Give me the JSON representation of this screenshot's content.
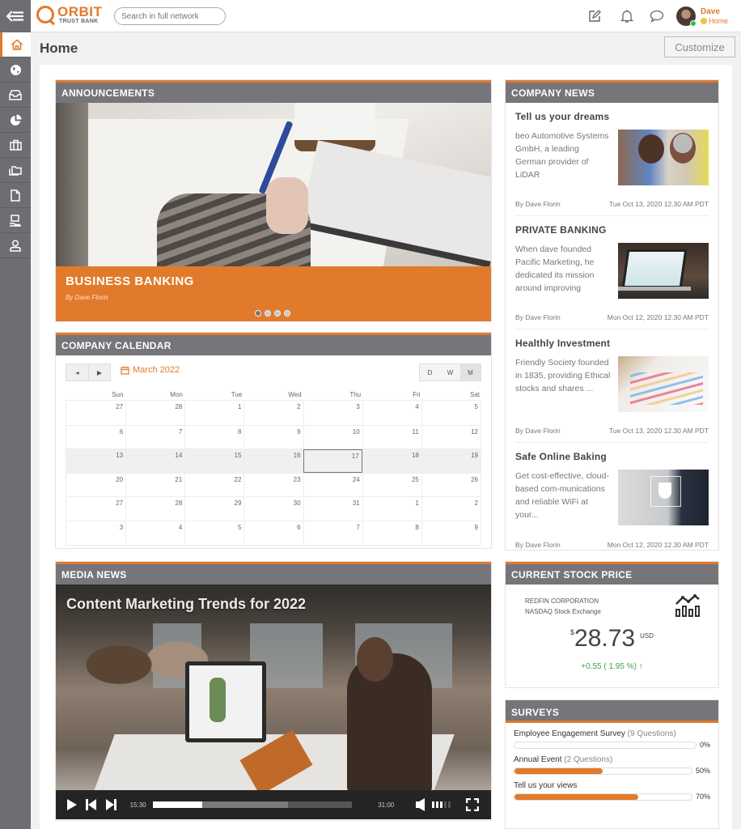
{
  "brand": {
    "name": "ORBIT",
    "tagline": "TRUST BANK",
    "accent_color": "#e27a2c",
    "header_gray": "#75757a"
  },
  "topbar": {
    "search_placeholder": "Search in full network",
    "icons": [
      "compose-icon",
      "bell-icon",
      "chat-icon"
    ],
    "user": {
      "name": "Dave",
      "status": "Home",
      "presence": "online"
    }
  },
  "sidebar": {
    "items": [
      {
        "name": "home",
        "icon": "home-icon",
        "active": true
      },
      {
        "name": "globe",
        "icon": "globe-icon"
      },
      {
        "name": "inbox",
        "icon": "inbox-icon"
      },
      {
        "name": "analytics",
        "icon": "pie-chart-icon"
      },
      {
        "name": "briefcase",
        "icon": "briefcase-icon"
      },
      {
        "name": "folders",
        "icon": "folders-icon"
      },
      {
        "name": "document",
        "icon": "document-icon"
      },
      {
        "name": "payments",
        "icon": "hand-card-icon"
      },
      {
        "name": "profile",
        "icon": "user-icon"
      }
    ]
  },
  "page": {
    "title": "Home",
    "customize_label": "Customize"
  },
  "announcements": {
    "header": "ANNOUNCEMENTS",
    "slide_title": "BUSINESS BANKING",
    "slide_author": "By Dave Florin",
    "slide_count": 4,
    "active_slide": 1
  },
  "calendar": {
    "header": "COMPANY CALENDAR",
    "prev_label": "◂",
    "next_label": "▶",
    "month_label": "March 2022",
    "views": [
      "D",
      "W",
      "M"
    ],
    "active_view": "M",
    "days_of_week": [
      "Sun",
      "Mon",
      "Tue",
      "Wed",
      "Thu",
      "Fri",
      "Sat"
    ],
    "weeks": [
      [
        "27",
        "28",
        "1",
        "2",
        "3",
        "4",
        "5"
      ],
      [
        "6",
        "7",
        "8",
        "9",
        "10",
        "11",
        "12"
      ],
      [
        "13",
        "14",
        "15",
        "16",
        "17",
        "18",
        "19"
      ],
      [
        "20",
        "21",
        "22",
        "23",
        "24",
        "25",
        "26"
      ],
      [
        "27",
        "28",
        "29",
        "30",
        "31",
        "1",
        "2"
      ],
      [
        "3",
        "4",
        "5",
        "6",
        "7",
        "8",
        "9"
      ]
    ],
    "current_week_index": 2,
    "today": "17"
  },
  "media": {
    "header": "MEDIA NEWS",
    "video_title": "Content Marketing Trends for 2022",
    "current_time": "15:30",
    "duration": "31:00",
    "played_fraction": 0.25,
    "buffered_fraction": 0.68,
    "volume_level": 3,
    "volume_max": 5
  },
  "news": {
    "header": "COMPANY NEWS",
    "items": [
      {
        "title": "Tell us your dreams",
        "text": "beo Automotive Systems GmbH, a leading German provider of LiDAR",
        "author": "By Dave Florin",
        "date": "Tue Oct 13, 2020 12.30 AM PDT",
        "image": "couple-photo"
      },
      {
        "title": "PRIVATE BANKING",
        "text": "When dave founded Pacific Marketing, he dedicated its mission around improving",
        "author": "By Dave Florin",
        "date": "Mon Oct 12, 2020 12.30 AM PDT",
        "image": "laptop-photo"
      },
      {
        "title": "Healthly Investment",
        "text": "Friendly Society founded in 1835, providing Ethical stocks and shares ...",
        "author": "By Dave Florin",
        "date": "Tue Oct 13, 2020 12.30 AM PDT",
        "image": "chart-photo"
      },
      {
        "title": "Safe Online Baking",
        "text": "Get cost-effective, cloud-based com-munications and reliable WiFi at your...",
        "author": "By Dave Florin",
        "date": "Mon Oct 12, 2020 12.30 AM PDT",
        "image": "security-photo"
      }
    ]
  },
  "stock": {
    "header": "CURRENT STOCK PRICE",
    "company": "REDFIN CORPORATION",
    "exchange": "NASDAQ Stock Exchange",
    "currency_symbol": "$",
    "price": "28.73",
    "currency": "USD",
    "change": "+0.55 ( 1.95 %) ↑",
    "change_color": "#43a047"
  },
  "surveys": {
    "header": "SURVEYS",
    "items": [
      {
        "title": "Employee Engagement Survey",
        "questions": "(9 Questions)",
        "percent": 0,
        "percent_label": "0%"
      },
      {
        "title": "Annual Event",
        "questions": "(2 Questions)",
        "percent": 50,
        "percent_label": "50%"
      },
      {
        "title": "Tell us your views",
        "questions": "",
        "percent": 70,
        "percent_label": "70%"
      }
    ]
  }
}
